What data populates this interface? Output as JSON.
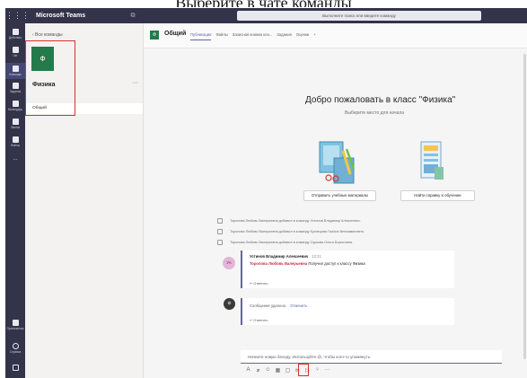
{
  "caption": "Выберите в чате команды",
  "titlebar": {
    "app_name": "Microsoft Teams",
    "search_placeholder": "Выполните поиск или введите команду"
  },
  "rail": {
    "items": [
      {
        "label": "Действия",
        "icon": "bell-icon"
      },
      {
        "label": "Чат",
        "icon": "chat-icon"
      },
      {
        "label": "Команды",
        "icon": "teams-icon",
        "active": true
      },
      {
        "label": "Задания",
        "icon": "assignments-icon"
      },
      {
        "label": "Календарь",
        "icon": "calendar-icon"
      },
      {
        "label": "Звонки",
        "icon": "phone-icon"
      },
      {
        "label": "Файлы",
        "icon": "files-icon"
      },
      {
        "label": "...",
        "icon": "more-icon"
      }
    ],
    "bottom_items": [
      {
        "label": "Приложения",
        "icon": "apps-icon"
      },
      {
        "label": "Справка",
        "icon": "help-icon"
      }
    ]
  },
  "team_panel": {
    "back_label": "‹  Все команды",
    "team_tile": "Ф",
    "team_name": "Физика",
    "more": "···",
    "channel": "Общий"
  },
  "channel": {
    "tile": "Ф",
    "title": "Общий",
    "tabs": [
      "Публикации",
      "Файлы",
      "Записная книжка кла...",
      "Задания",
      "Оценки",
      "+"
    ],
    "active_tab": 0
  },
  "welcome": {
    "title": "Добро пожаловать в класс \"Физика\"",
    "subtitle": "Выберите место для начала",
    "button_upload": "Отправить учебные материалы",
    "button_help": "Найти справку и обучение"
  },
  "system_messages": [
    "Торопова Любовь Валерьевна добавил в команду Устинов Владимир Алексеевич.",
    "Торопова Любовь Валерьевна добавил в команду Кузнецова Галина Вениаминовна.",
    "Торопова Любовь Валерьевна добавил в команду Суркова Ольга Борисовна."
  ],
  "posts": [
    {
      "avatar": "УА",
      "author": "Устинов Владимир Алексеевич",
      "time": "12:21",
      "mention": "Торопова Любовь Валерьевна",
      "text": "Получил доступ к классу Физика",
      "reply": "↩ Ответить"
    },
    {
      "avatar": "",
      "deleted_text": "Сообщение удалено.",
      "undo": "Отменить",
      "reply": "↩ Ответить"
    }
  ],
  "composer": {
    "placeholder": "Начните новую беседу. Используйте @, чтобы кого-то упомянуть."
  },
  "toolbar": {
    "icons": [
      "format-icon",
      "attach-icon",
      "emoji-icon",
      "gif-icon",
      "sticker-icon",
      "meet-icon",
      "send-icon",
      "praise-icon",
      "more-icon"
    ],
    "glyphs": [
      "A",
      "⌀",
      "☺",
      "▦",
      "▢",
      "⊳",
      "▷",
      "♀",
      "···"
    ]
  },
  "colors": {
    "rail": "#33344a",
    "accent": "#6264a7",
    "team_tile": "#237b4b",
    "highlight_box": "#d9302c",
    "mention": "#c4314b"
  }
}
